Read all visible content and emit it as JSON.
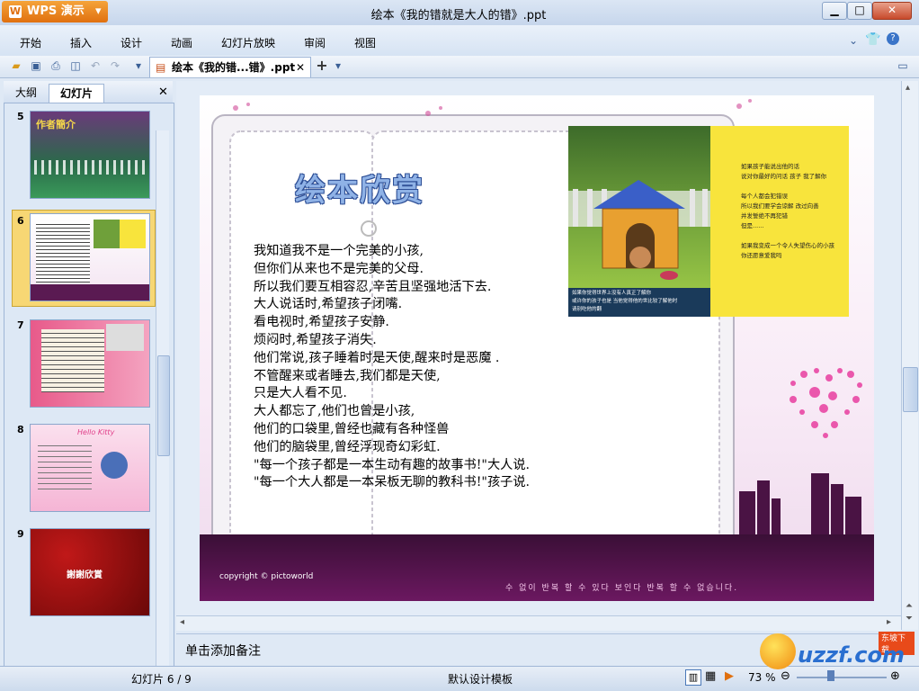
{
  "app": {
    "brand": "WPS 演示",
    "window_title": "绘本《我的错就是大人的错》.ppt"
  },
  "menu": [
    "开始",
    "插入",
    "设计",
    "动画",
    "幻灯片放映",
    "审阅",
    "视图"
  ],
  "document_tab": {
    "label": "绘本《我的错...错》.ppt"
  },
  "left_pane": {
    "tabs": [
      "大纲",
      "幻灯片"
    ],
    "active_tab": "幻灯片",
    "thumbnails": [
      {
        "number": "5",
        "text": "作者簡介"
      },
      {
        "number": "6",
        "text": ""
      },
      {
        "number": "7",
        "text": ""
      },
      {
        "number": "8",
        "text": "Hello Kitty"
      },
      {
        "number": "9",
        "text": "謝謝欣賞"
      }
    ],
    "selected_number": "6"
  },
  "slide": {
    "title": "绘本欣赏",
    "lines": [
      "我知道我不是一个完美的小孩,",
      "但你们从来也不是完美的父母.",
      "所以我们要互相容忍,辛苦且坚强地活下去.",
      "大人说话时,希望孩子闭嘴.",
      "看电视时,希望孩子安静.",
      "烦闷时,希望孩子消失.",
      "他们常说,孩子睡着时是天使,醒来时是恶魔 .",
      "不管醒来或者睡去,我们都是天使,",
      "只是大人看不见.",
      "大人都忘了,他们也曾是小孩,",
      "他们的口袋里,曾经也藏有各种怪兽",
      "他们的脑袋里,曾经浮现奇幻彩虹.",
      "\"每一个孩子都是一本生动有趣的故事书!\"大人说.",
      "\"每一个大人都是一本呆板无聊的教科书!\"孩子说."
    ],
    "picture_text": [
      "如果孩子能说出他的话",
      "说对你最好的问话 孩子 我了解你",
      "每个人都会犯错误",
      "所以我们要学会谅解 改过向善",
      "并发誓绝不再犯错",
      "但是......",
      "如果我变成一个令人失望伤心的小孩",
      "你还愿意爱我吗"
    ],
    "picture_caption": [
      "如果你觉得世界上没有人真正了解你",
      "或许你的孩子也是 当他觉得他的世比较了解他时",
      "请别吃他的翻"
    ],
    "copyright": "copyright © pictoworld",
    "footer_text": "수 없이 반복 할 수 있다 보인다 반복 할 수 없습니다."
  },
  "notes": {
    "placeholder": "单击添加备注"
  },
  "status": {
    "slide_indicator": "幻灯片 6 / 9",
    "template": "默认设计模板",
    "zoom": "73 %"
  },
  "watermark": {
    "text": "uzzf.com",
    "tag": "东坡下载"
  },
  "colors": {
    "accent_orange": "#e0700f",
    "title_blue": "#8fb2e6",
    "selected_thumb": "#f7d774"
  }
}
